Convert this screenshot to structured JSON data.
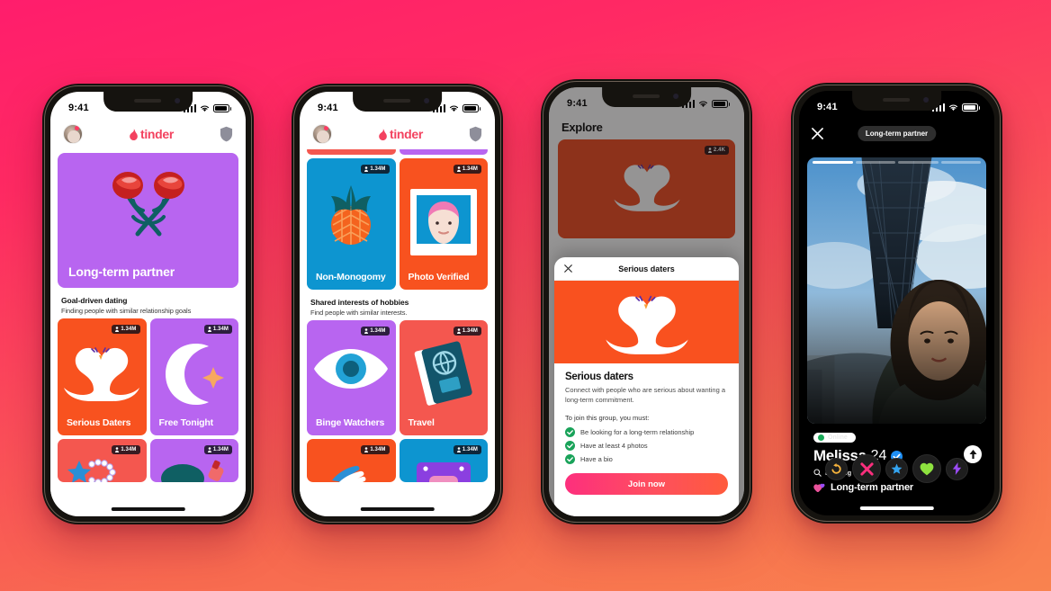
{
  "background": {
    "from": "#ff1d6c",
    "to": "#f9834f"
  },
  "status_bar": {
    "time": "9:41",
    "signal_icon": "cellular-bars-icon",
    "wifi_icon": "wifi-icon",
    "battery_icon": "battery-icon"
  },
  "brand": {
    "name": "tinder",
    "color": "#f3425f",
    "flame_icon": "flame-icon",
    "shield_icon": "shield-icon",
    "avatar_icon": "profile-avatar"
  },
  "phone1": {
    "hero": {
      "title": "Long-term partner",
      "color": "#b865f0",
      "art": "crossed-roses-icon"
    },
    "section": {
      "heading": "Goal-driven dating",
      "sub": "Finding people with similar relationship goals"
    },
    "tiles": [
      {
        "label": "Serious Daters",
        "count": "1.34M",
        "color": "#f8521f",
        "art": "swans-heart-icon"
      },
      {
        "label": "Free Tonight",
        "count": "1.34M",
        "color": "#b865f0",
        "art": "moon-sparkle-icon"
      },
      {
        "label": "",
        "count": "1.34M",
        "color": "#f4574f",
        "art": "friendship-bracelet-icon"
      },
      {
        "label": "",
        "count": "1.34M",
        "color": "#b865f0",
        "art": "nail-polish-icon"
      }
    ]
  },
  "phone2": {
    "strips": [
      {
        "color": "#f4574f"
      },
      {
        "color": "#b865f0"
      }
    ],
    "tiles_top": [
      {
        "label": "Non-Monogomy",
        "count": "1.34M",
        "color": "#0d95d0",
        "art": "pineapple-icon"
      },
      {
        "label": "Photo Verified",
        "count": "1.34M",
        "color": "#f8521f",
        "art": "photo-portrait-icon"
      }
    ],
    "section": {
      "heading": "Shared interests of hobbies",
      "sub": "Find people with similar interests."
    },
    "tiles_bottom": [
      {
        "label": "Binge Watchers",
        "count": "1.34M",
        "color": "#b865f0",
        "art": "eye-icon"
      },
      {
        "label": "Travel",
        "count": "1.34M",
        "color": "#f4574f",
        "art": "passport-icon"
      },
      {
        "label": "",
        "count": "1.34M",
        "color": "#f8521f",
        "art": "hand-icon"
      },
      {
        "label": "",
        "count": "1.34M",
        "color": "#0d95d0",
        "art": "game-console-icon"
      }
    ]
  },
  "phone3": {
    "explore_title": "Explore",
    "card_count": "2.4K",
    "sheet": {
      "close_icon": "close-icon",
      "header_title": "Serious daters",
      "hero_art": "swans-heart-icon",
      "hero_color": "#f9511f",
      "title": "Serious daters",
      "description": "Connect with people who are serious about wanting a long-term commitment.",
      "requirements_intro": "To join this group, you must:",
      "requirements": [
        "Be looking for a long-term relationship",
        "Have at least 4 photos",
        "Have a bio"
      ],
      "cta": "Join now",
      "cta_from": "#fd2f7d",
      "cta_to": "#ff5b3c"
    }
  },
  "phone4": {
    "close_icon": "close-icon",
    "tag": "Long-term partner",
    "photo_alt": "bridge-and-portrait-photo",
    "photo_steps": 4,
    "photo_active": 1,
    "online_label": "Online",
    "name": "Melissa",
    "age": "24",
    "verified_icon": "verified-badge-icon",
    "info_icon": "info-arrow-icon",
    "looking_for_label": "Looking for",
    "looking_for_icon": "search-icon",
    "looking_for_value": "Long-term partner",
    "looking_for_emoji": "two-hearts-icon",
    "actions": [
      {
        "name": "rewind",
        "icon": "rewind-icon",
        "color": "#f6b33c"
      },
      {
        "name": "nope",
        "icon": "close-x-icon",
        "color": "#fd2f7d"
      },
      {
        "name": "superlike",
        "icon": "star-icon",
        "color": "#34a4f0"
      },
      {
        "name": "like",
        "icon": "heart-icon",
        "color": "#8ee23f"
      },
      {
        "name": "boost",
        "icon": "lightning-icon",
        "color": "#9b4bf5"
      }
    ]
  }
}
